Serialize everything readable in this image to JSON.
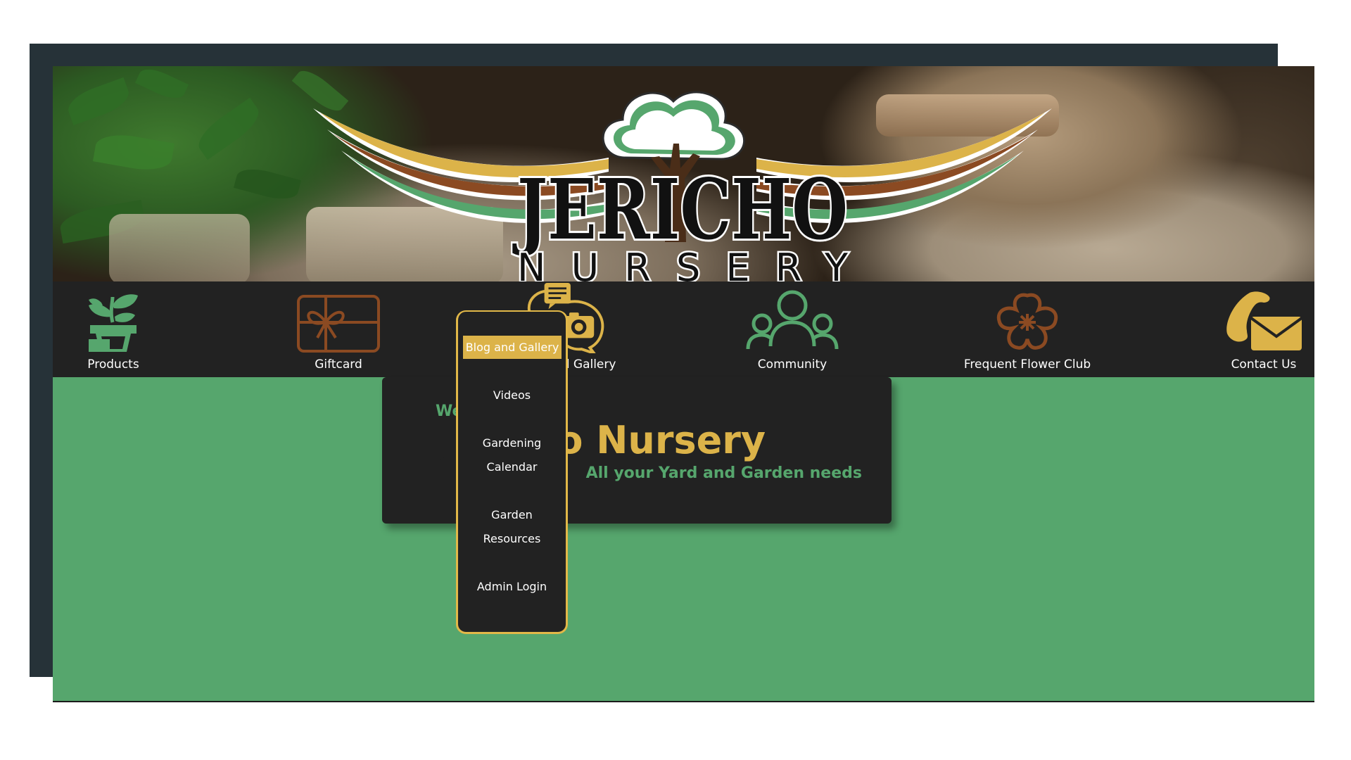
{
  "logo": {
    "wordmark": "JERICHO",
    "subtitle": "NURSERY"
  },
  "nav": {
    "items": [
      {
        "label": "Products",
        "icon": "potted-plant-icon"
      },
      {
        "label": "Giftcard",
        "icon": "gift-card-icon"
      },
      {
        "label": "Blog and Gallery",
        "icon": "chat-camera-icon"
      },
      {
        "label": "Community",
        "icon": "people-group-icon"
      },
      {
        "label": "Frequent Flower Club",
        "icon": "flower-icon"
      },
      {
        "label": "Contact Us",
        "icon": "phone-envelope-icon"
      }
    ]
  },
  "dropdown": {
    "items": [
      {
        "label": "Blog and Gallery",
        "active": true
      },
      {
        "label": "Videos"
      },
      {
        "label": "Gardening Calendar"
      },
      {
        "label": "Garden Resources"
      },
      {
        "label": "Admin Login"
      }
    ]
  },
  "welcome": {
    "small_text": "We",
    "title_visible": "cho Nursery",
    "subtitle": "All your Yard and Garden needs"
  },
  "colors": {
    "green": "#56a66d",
    "gold": "#dcb349",
    "brown": "#8b4a22",
    "dark": "#222222",
    "backdrop": "#263238"
  }
}
